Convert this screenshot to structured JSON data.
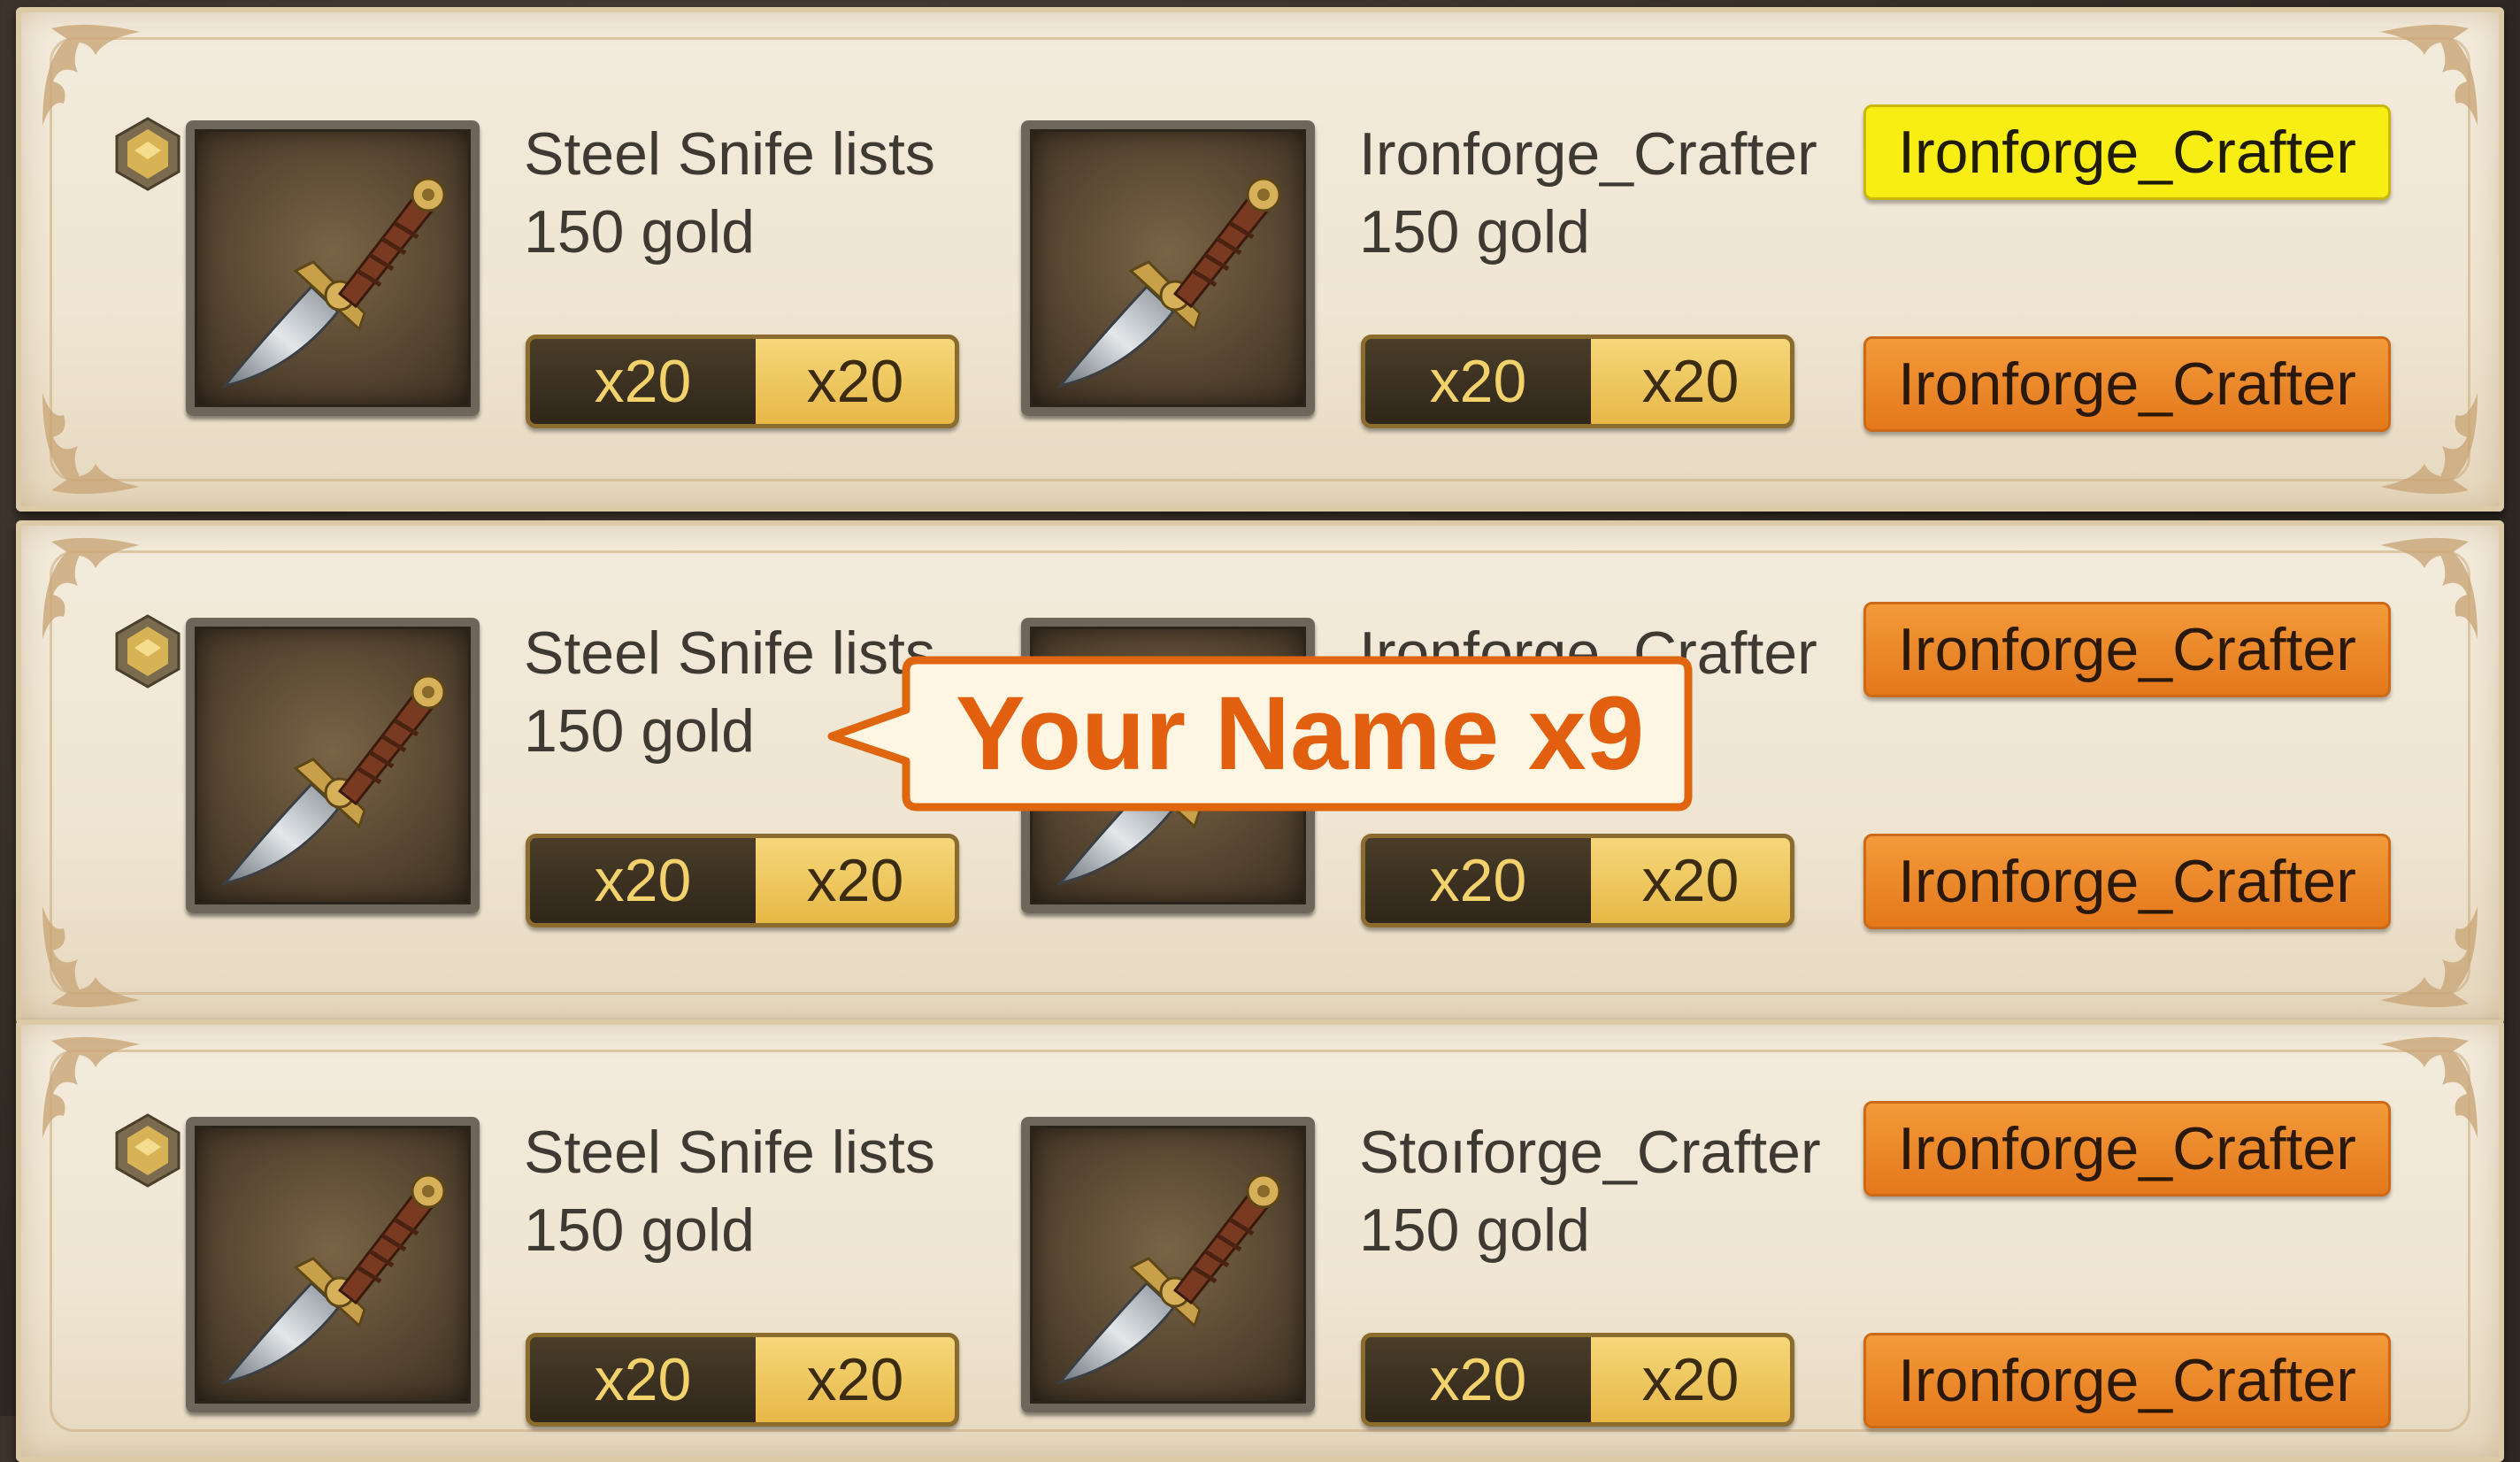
{
  "rows": [
    {
      "left": {
        "name": "Steel Snife lists",
        "price": "150 gold",
        "qty_a": "x20",
        "qty_b": "x20"
      },
      "right": {
        "name": "Ironforge_Crafter",
        "price": "150 gold",
        "qty_a": "x20",
        "qty_b": "x20"
      },
      "tag_top": "Ironforge_Crafter",
      "tag_top_color": "#f9ee13",
      "tag_bottom": "Ironforge_Crafter",
      "tag_bottom_color": "#f0892a"
    },
    {
      "left": {
        "name": "Steel Snife lists",
        "price": "150 gold",
        "qty_a": "x20",
        "qty_b": "x20"
      },
      "right": {
        "name": "Ironforge_Crafter",
        "price": "",
        "qty_a": "x20",
        "qty_b": "x20"
      },
      "tag_top": "Ironforge_Crafter",
      "tag_top_color": "#f0892a",
      "tag_bottom": "Ironforge_Crafter",
      "tag_bottom_color": "#f0892a"
    },
    {
      "left": {
        "name": "Steel Snife lists",
        "price": "150 gold",
        "qty_a": "x20",
        "qty_b": "x20"
      },
      "right": {
        "name": "Stoıforge_Crafter",
        "price": "150 gold",
        "qty_a": "x20",
        "qty_b": "x20"
      },
      "tag_top": "Ironforge_Crafter",
      "tag_top_color": "#f0892a",
      "tag_bottom": "Ironforge_Crafter",
      "tag_bottom_color": "#f0892a"
    }
  ],
  "callout": {
    "text": "Your Name x9"
  },
  "icons": {
    "item": "dagger-icon",
    "rank": "diamond-rank-icon"
  }
}
